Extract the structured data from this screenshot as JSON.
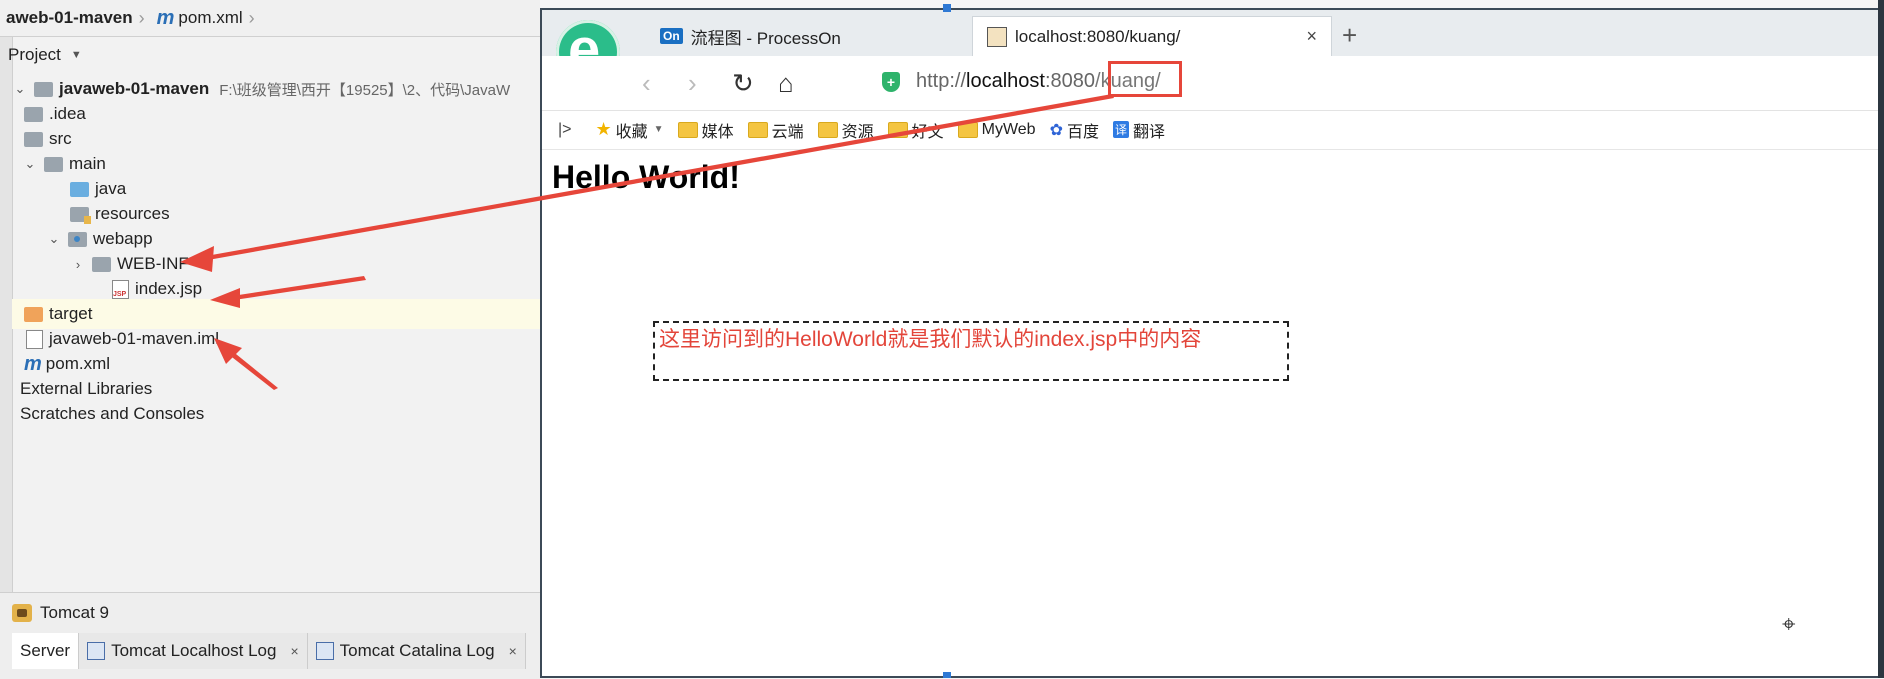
{
  "ide": {
    "breadcrumb": {
      "project": "aweb-01-maven",
      "file": "pom.xml",
      "file_icon": "m"
    },
    "project_header": {
      "label": "Project"
    },
    "tree": {
      "root": {
        "name": "javaweb-01-maven",
        "path": "F:\\班级管理\\西开【19525】\\2、代码\\JavaW"
      },
      "idea": ".idea",
      "src": "src",
      "main": "main",
      "java": "java",
      "resources": "resources",
      "webapp": "webapp",
      "webinf": "WEB-INF",
      "index": "index.jsp",
      "index_badge": "JSP",
      "target": "target",
      "iml": "javaweb-01-maven.iml",
      "pom": "pom.xml",
      "pom_icon": "m",
      "external": "External Libraries",
      "scratches": "Scratches and Consoles"
    },
    "run": {
      "config": "Tomcat 9"
    },
    "log_tabs": {
      "server": "Server",
      "localhost_log": "Tomcat Localhost Log",
      "catalina_log": "Tomcat Catalina Log",
      "close": "×"
    }
  },
  "browser": {
    "tabs": {
      "tab1": {
        "badge": "On",
        "title": "流程图 - ProcessOn"
      },
      "tab2": {
        "title": "localhost:8080/kuang/",
        "close": "×"
      },
      "new_tab": "+"
    },
    "nav": {
      "back": "‹",
      "forward": "›",
      "refresh": "↻",
      "home": "⌂"
    },
    "address": {
      "scheme": "http://",
      "host": "localhost",
      "port": ":8080",
      "path": "/kuang/"
    },
    "bookmarks": {
      "toggle": "|>",
      "favorites": "收藏",
      "items": [
        "媒体",
        "云端",
        "资源",
        "好文",
        "MyWeb"
      ],
      "baidu": "百度",
      "translate_badge": "译",
      "translate": "翻译"
    },
    "page": {
      "heading": "Hello World!",
      "annotation": "这里访问到的HelloWorld就是我们默认的index.jsp中的内容"
    }
  },
  "colors": {
    "annotation_red": "#e6463a",
    "browser_logo": "#2bbd8a"
  },
  "icons": [
    "folder-icon",
    "jsp-file-icon",
    "maven-icon",
    "tomcat-icon",
    "shield-icon",
    "star-icon",
    "baidu-paw-icon",
    "crosshair-icon"
  ]
}
